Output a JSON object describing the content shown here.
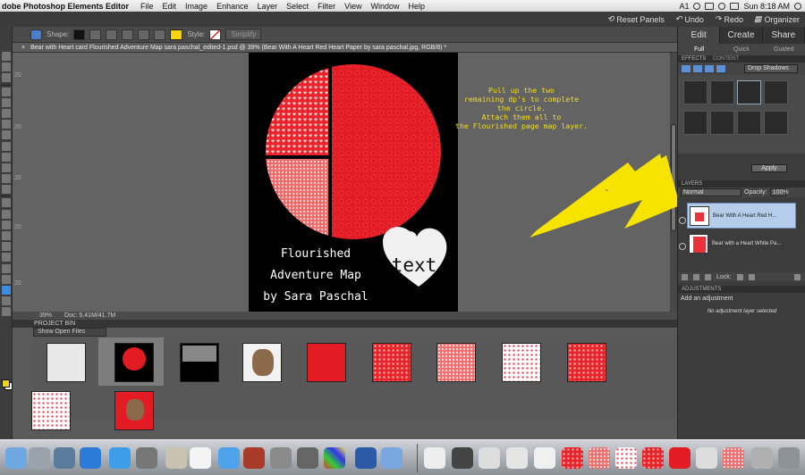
{
  "menubar": {
    "app_name": "dobe Photoshop Elements Editor",
    "items": [
      "File",
      "Edit",
      "Image",
      "Enhance",
      "Layer",
      "Select",
      "Filter",
      "View",
      "Window",
      "Help"
    ],
    "status_text": "A1",
    "clock": "Sun 8:18 AM"
  },
  "header": {
    "reset_panels": "Reset Panels",
    "undo": "Undo",
    "redo": "Redo",
    "organizer": "Organizer"
  },
  "options_bar": {
    "shape_label": "Shape:",
    "style_label": "Style:",
    "simplify_label": "Simplify",
    "color_swatch": "#f5d50a"
  },
  "document": {
    "tab_title": "Bear with Heart card Flourished Adventure Map sara paschal_edited-1.psd @ 39% (Bear With A Heart Red Heart Paper by sara paschal.jpg, RGB/8) *",
    "zoom": "39%",
    "doc_size": "Doc: 5.41M/41.7M",
    "title_lines": [
      "Flourished",
      "Adventure Map",
      "by Sara Paschal"
    ],
    "heart_text": "text"
  },
  "ruler": [
    "20",
    "20",
    "20",
    "20",
    "20"
  ],
  "instruction_text": [
    "Pull up the two",
    "remaining dp's to complete",
    "the circle.",
    "Attach them all to",
    "the Flourished page map layer."
  ],
  "project_bin": {
    "header": "PROJECT BIN",
    "dropdown": "Show Open Files"
  },
  "right_panel": {
    "tabs": [
      "Edit",
      "Create",
      "Share"
    ],
    "subtabs": [
      "Full",
      "Quick",
      "Guided"
    ],
    "effects_header": "EFFECTS",
    "content_tab": "CONTENT",
    "effect_dropdown": "Drop Shadows",
    "apply_button": "Apply",
    "layers_header": "LAYERS",
    "blend_mode": "Normal",
    "opacity_label": "Opacity:",
    "opacity_value": "100%",
    "layers": [
      {
        "name": "Bear With A Heart Red H..."
      },
      {
        "name": "Bear with a Heart White Pa..."
      }
    ],
    "lock_label": "Lock:",
    "adjustments_header": "ADJUSTMENTS",
    "add_adjustment": "Add an adjustment",
    "no_adjustment": "No adjustment layer selected"
  },
  "colors": {
    "accent_yellow": "#f5d50a",
    "heart_red": "#e31b23",
    "panel_dark": "#3c3c3c"
  }
}
